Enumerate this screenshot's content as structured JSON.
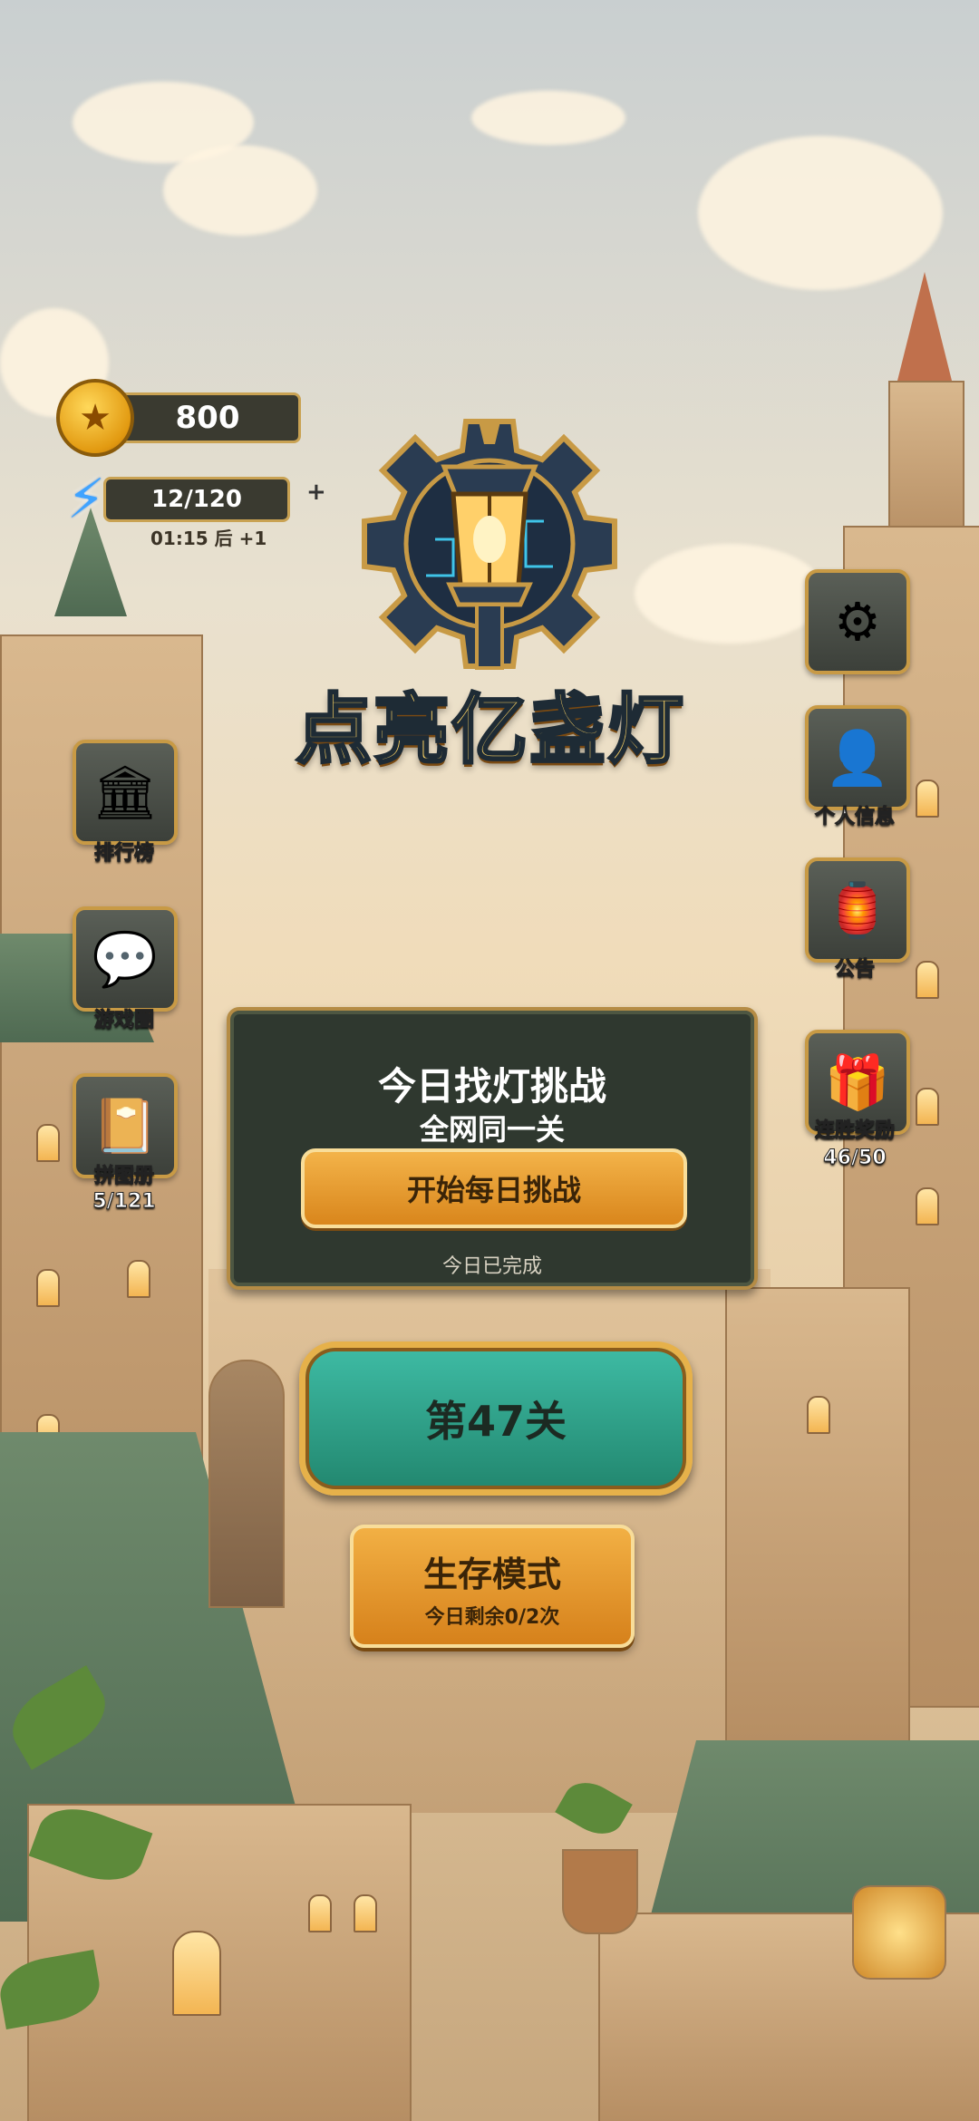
{
  "currency": {
    "coins": "800",
    "energy": "12/120",
    "energy_plus": "+",
    "energy_timer": "01:15 后 +1"
  },
  "logo": {
    "title": "点亮亿盏灯"
  },
  "left_menu": [
    {
      "label": "排行榜",
      "icon": "leaderboard-icon"
    },
    {
      "label": "游戏圈",
      "icon": "game-circle-icon"
    },
    {
      "label": "拼图册",
      "progress": "5/121",
      "icon": "puzzle-book-icon"
    }
  ],
  "right_menu": [
    {
      "label": "",
      "icon": "settings-icon"
    },
    {
      "label": "个人信息",
      "icon": "profile-icon"
    },
    {
      "label": "公告",
      "icon": "announcement-icon"
    },
    {
      "label": "连胜奖励",
      "progress": "46/50",
      "icon": "streak-reward-icon"
    }
  ],
  "daily": {
    "title": "今日找灯挑战",
    "subtitle": "全网同一关",
    "button": "开始每日挑战",
    "status": "今日已完成"
  },
  "level": {
    "label": "第47关"
  },
  "survival": {
    "title": "生存模式",
    "remaining": "今日剩余0/2次"
  },
  "colors": {
    "gold": "#c89a45",
    "teal": "#2aa08a",
    "orange": "#e39a2c",
    "panel": "#2f382f"
  }
}
